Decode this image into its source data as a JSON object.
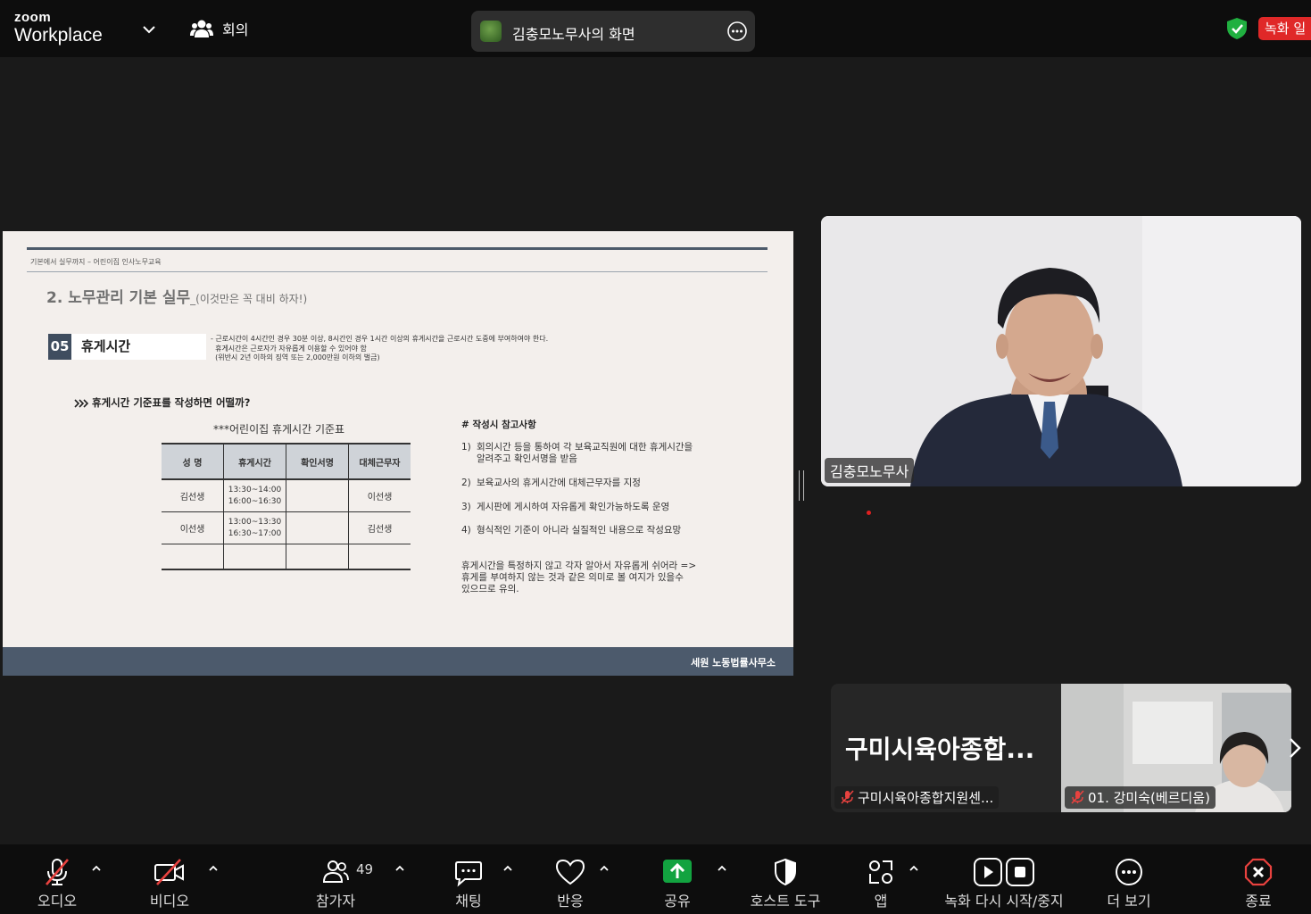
{
  "header": {
    "logo_top": "zoom",
    "logo_bottom": "Workplace",
    "meeting_label": "회의",
    "share_title": "김충모노무사의 화면",
    "recording_badge": "녹화 일"
  },
  "slide": {
    "small_header": "기본에서 실무까지 – 어린이집 인사노무교육",
    "title": "2. 노무관리 기본 실무",
    "title_sub": "_(이것만은 꼭 대비 하자!)",
    "section_number": "05",
    "section_title": "휴게시간",
    "section_note": "- 근로시간이 4시간인 경우 30분 이상, 8시간인 경우 1시간 이상의 휴게시간을 근로시간 도중에 부여하여야 한다.\n  휴게시간은 근로자가 자유롭게 이용할 수 있어야 함\n  (위반시 2년 이하의 징역 또는 2,000만원 이하의 벌금)",
    "question": "휴게시간 기준표를 작성하면 어떨까?",
    "table_title": "***어린이집 휴게시간 기준표",
    "table_headers": [
      "성 명",
      "휴게시간",
      "확인서명",
      "대체근무자"
    ],
    "table_rows": [
      [
        "김선생",
        "13:30~14:00\n16:00~16:30",
        "",
        "이선생"
      ],
      [
        "이선생",
        "13:00~13:30\n16:30~17:00",
        "",
        "김선생"
      ],
      [
        "",
        "",
        "",
        ""
      ]
    ],
    "notes_heading": "# 작성시 참고사항",
    "notes": [
      {
        "num": "1)",
        "text": "회의시간 등을 통하여 각 보육교직원에 대한 휴게시간을\n알려주고 확인서명을 받음"
      },
      {
        "num": "2)",
        "text": "보육교사의 휴게시간에 대체근무자를 지정"
      },
      {
        "num": "3)",
        "text": "게시판에 게시하여 자유롭게 확인가능하도록 운영"
      },
      {
        "num": "4)",
        "text": "형식적인 기준이 아니라 실질적인 내용으로 작성요망"
      }
    ],
    "warning": "휴게시간을 특정하지 않고 각자 알아서 자유롭게 쉬어라 =>\n휴게를 부여하지 않는 것과 같은 의미로 볼 여지가 있을수\n있으므로 유의.",
    "footer": "세원 노동법률사무소"
  },
  "main_video": {
    "name": "김충모노무사"
  },
  "tiles": [
    {
      "display": "구미시육아종합...",
      "label": "구미시육아종합지원센..."
    },
    {
      "display": "",
      "label": "01. 강미숙(베르디움)"
    }
  ],
  "toolbar": {
    "audio": "오디오",
    "video": "비디오",
    "participants": "참가자",
    "participant_count": "49",
    "chat": "채팅",
    "react": "반응",
    "share": "공유",
    "host_tools": "호스트 도구",
    "apps": "앱",
    "recording": "녹화 다시 시작/중지",
    "more": "더 보기",
    "end": "종료"
  },
  "colors": {
    "share_green": "#12a340",
    "end_red": "#e8423f",
    "rec_red": "#e02828",
    "shield_green": "#20b040"
  }
}
